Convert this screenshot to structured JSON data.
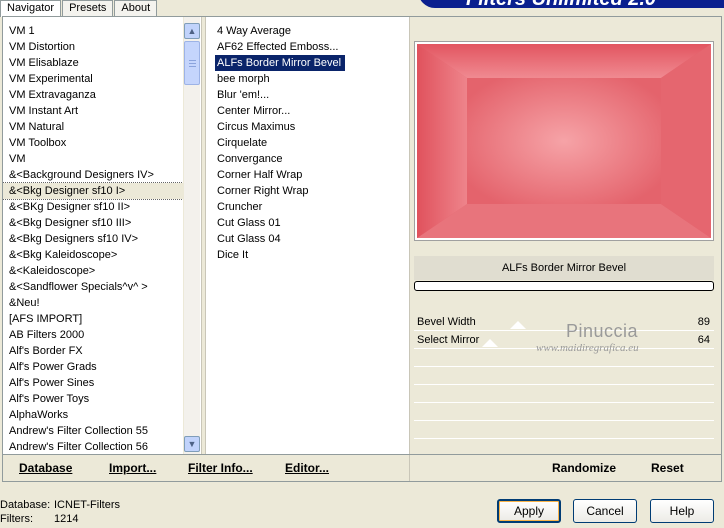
{
  "tabs": [
    "Navigator",
    "Presets",
    "About"
  ],
  "banner_title": "Filters Unlimited 2.0",
  "categories": [
    "VM 1",
    "VM Distortion",
    "VM Elisablaze",
    "VM Experimental",
    "VM Extravaganza",
    "VM Instant Art",
    "VM Natural",
    "VM Toolbox",
    "VM",
    "&<Background Designers IV>",
    "&<Bkg Designer sf10 I>",
    "&<BKg Designer sf10 II>",
    "&<Bkg Designer sf10 III>",
    "&<Bkg Designers sf10 IV>",
    "&<Bkg Kaleidoscope>",
    "&<Kaleidoscope>",
    "&<Sandflower Specials^v^ >",
    "&Neu!",
    "[AFS IMPORT]",
    "AB Filters 2000",
    "Alf's Border FX",
    "Alf's Power Grads",
    "Alf's Power Sines",
    "Alf's Power Toys",
    "AlphaWorks",
    "Andrew's Filter Collection 55",
    "Andrew's Filter Collection 56"
  ],
  "selected_category": "&<Bkg Designer sf10 I>",
  "filters": [
    "4 Way Average",
    "AF62 Effected Emboss...",
    "ALFs Border Mirror Bevel",
    "bee morph",
    "Blur 'em!...",
    "Center Mirror...",
    "Circus Maximus",
    "Cirquelate",
    "Convergance",
    "Corner Half Wrap",
    "Corner Right Wrap",
    "Cruncher",
    "Cut Glass 01",
    "Cut Glass 04",
    "Dice It"
  ],
  "selected_filter": "ALFs Border Mirror Bevel",
  "preview": {
    "color": "#e25e68"
  },
  "current_filter_name": "ALFs Border Mirror Bevel",
  "params": [
    {
      "label": "Bevel Width",
      "value": "89"
    },
    {
      "label": "Select Mirror",
      "value": "64"
    }
  ],
  "watermark": {
    "name": "Pinuccia",
    "url": "www.maidiregrafica.eu"
  },
  "actions": {
    "database": "Database",
    "import": "Import...",
    "filter_info": "Filter Info...",
    "editor": "Editor...",
    "randomize": "Randomize",
    "reset": "Reset"
  },
  "status": {
    "database_label": "Database:",
    "database_value": "ICNET-Filters",
    "filters_label": "Filters:",
    "filters_value": "1214"
  },
  "buttons": {
    "apply": "Apply",
    "cancel": "Cancel",
    "help": "Help"
  }
}
